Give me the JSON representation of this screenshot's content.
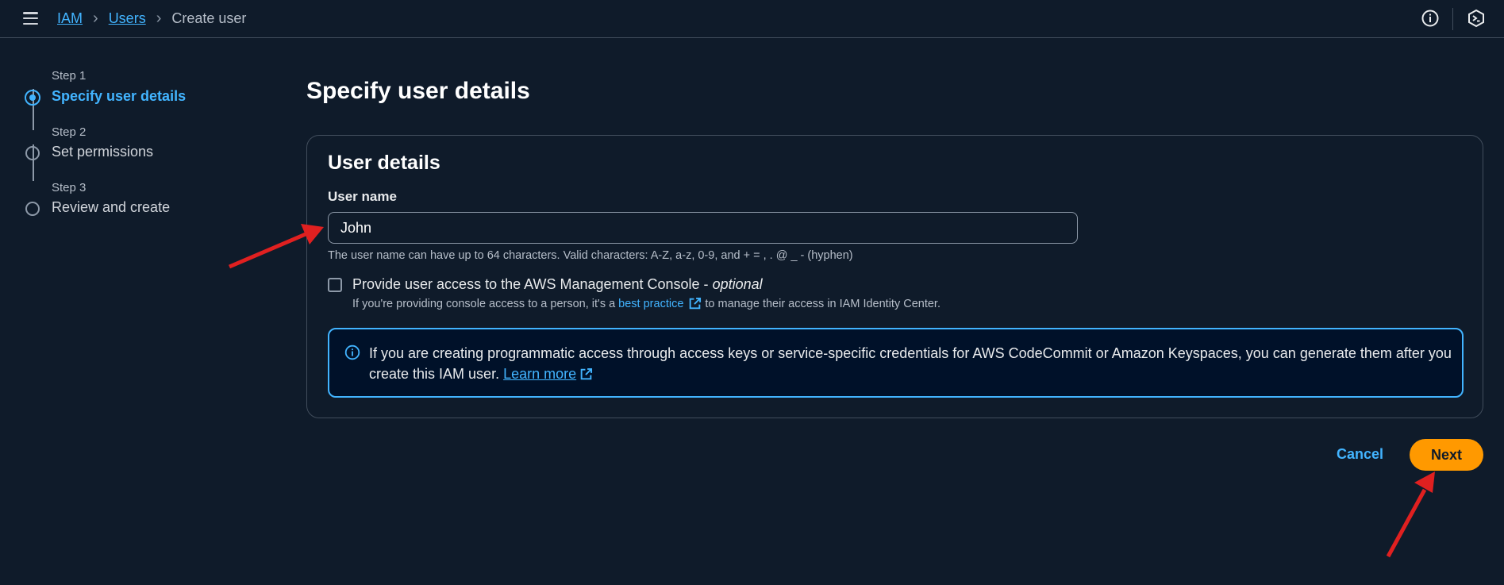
{
  "breadcrumb": {
    "items": [
      "IAM",
      "Users"
    ],
    "current": "Create user"
  },
  "steps": [
    {
      "label": "Step 1",
      "title": "Specify user details",
      "active": true
    },
    {
      "label": "Step 2",
      "title": "Set permissions",
      "active": false
    },
    {
      "label": "Step 3",
      "title": "Review and create",
      "active": false
    }
  ],
  "page": {
    "title": "Specify user details"
  },
  "panel": {
    "title": "User details",
    "username_label": "User name",
    "username_value": "John",
    "username_hint": "The user name can have up to 64 characters. Valid characters: A-Z, a-z, 0-9, and + = , . @ _ - (hyphen)",
    "console_label": "Provide user access to the AWS Management Console - ",
    "console_optional": "optional",
    "console_checked": false,
    "console_hint_pre": "If you're providing console access to a person, it's a",
    "console_hint_link": "best practice",
    "console_hint_post": "to manage their access in IAM Identity Center.",
    "alert_text": "If you are creating programmatic access through access keys or service-specific credentials for AWS CodeCommit or Amazon Keyspaces, you can generate them after you create this IAM user.",
    "alert_link": "Learn more"
  },
  "actions": {
    "cancel": "Cancel",
    "next": "Next"
  },
  "colors": {
    "accent": "#42b4ff",
    "primary_button": "#ff9900",
    "background": "#0f1b2a",
    "annotation": "#e02020"
  },
  "icons": [
    "menu-icon",
    "info-icon",
    "cloudshell-icon",
    "external-link-icon",
    "info-circle-icon",
    "annotation-arrow"
  ]
}
